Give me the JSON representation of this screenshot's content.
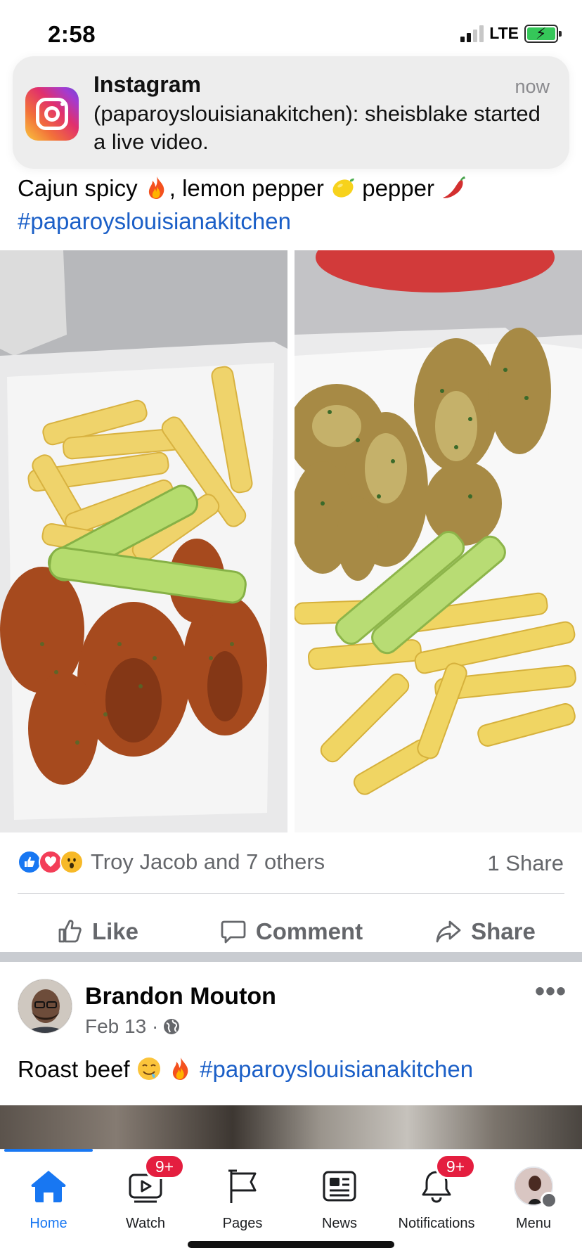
{
  "status_bar": {
    "time": "2:58",
    "network": "LTE",
    "signal_bars_active": 2,
    "signal_bars_total": 4,
    "battery_charging": true
  },
  "notification": {
    "app": "Instagram",
    "time": "now",
    "message": "(paparoyslouisianakitchen): sheisblake started a live video.",
    "icon": "instagram-icon"
  },
  "post1": {
    "text_parts": {
      "a": "Cajun spicy ",
      "b": ", lemon pepper ",
      "c": " pepper ",
      "hashtag": "#paparoyslouisianakitchen"
    },
    "emojis": [
      "fire-emoji",
      "lemon-emoji",
      "hot-pepper-emoji"
    ],
    "photos": [
      "wings-fries-celery-photo",
      "lemon-pepper-wings-fries-photo"
    ],
    "reactions": {
      "types": [
        "like",
        "love",
        "wow"
      ],
      "text": "Troy Jacob and 7 others"
    },
    "shares": "1 Share",
    "actions": {
      "like": "Like",
      "comment": "Comment",
      "share": "Share"
    }
  },
  "post2": {
    "author": "Brandon Mouton",
    "date": "Feb 13 ·",
    "privacy_icon": "globe-icon",
    "text_parts": {
      "a": "Roast beef ",
      "hashtag": "#paparoyslouisianakitchen"
    },
    "emojis": [
      "drooling-face-emoji",
      "fire-emoji"
    ]
  },
  "bottom_nav": {
    "items": [
      {
        "label": "Home",
        "icon": "home-icon",
        "active": true
      },
      {
        "label": "Watch",
        "icon": "watch-icon",
        "badge": "9+"
      },
      {
        "label": "Pages",
        "icon": "flag-icon"
      },
      {
        "label": "News",
        "icon": "news-icon"
      },
      {
        "label": "Notifications",
        "icon": "bell-icon",
        "badge": "9+"
      },
      {
        "label": "Menu",
        "icon": "profile-avatar"
      }
    ]
  },
  "colors": {
    "accent": "#1877f2",
    "hashtag": "#1b5fc7",
    "badge": "#e41e3f",
    "secondary_text": "#65676b"
  }
}
